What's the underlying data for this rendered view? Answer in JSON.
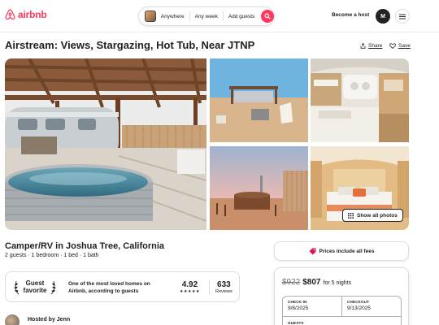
{
  "header": {
    "logo_text": "airbnb",
    "search": {
      "where": "Anywhere",
      "when": "Any week",
      "guests": "Add guests"
    },
    "become_host": "Become a host",
    "avatar_initial": "M"
  },
  "listing": {
    "title": "Airstream: Views, Stargazing, Hot Tub, Near JTNP",
    "share_label": "Share",
    "save_label": "Save",
    "show_all_photos": "Show all photos",
    "property_type": "Camper/RV in Joshua Tree, California",
    "details": "2 guests · 1 bedroom · 1 bed · 1 bath",
    "guest_favorite": {
      "badge_line1": "Guest",
      "badge_line2": "favorite",
      "description": "One of the most loved homes on Airbnb, according to guests",
      "rating": "4.92",
      "stars": "★★★★★",
      "reviews_count": "633",
      "reviews_label": "Reviews"
    },
    "host_line": "Hosted by Jenn"
  },
  "booking": {
    "price_note": "Prices include all fees",
    "old_price": "$922",
    "new_price": "$807",
    "nights": "for 5 nights",
    "checkin_label": "CHECK-IN",
    "checkin_value": "9/8/2025",
    "checkout_label": "CHECKOUT",
    "checkout_value": "9/13/2025",
    "guests_label": "GUESTS"
  },
  "colors": {
    "brand": "#ff385c",
    "text": "#222222",
    "muted": "#717171",
    "border": "#dddddd"
  },
  "icons": [
    "airbnb-logo-icon",
    "search-icon",
    "hamburger-menu-icon",
    "share-icon",
    "heart-icon",
    "grid-icon",
    "laurel-left-icon",
    "laurel-right-icon",
    "price-tag-icon"
  ]
}
